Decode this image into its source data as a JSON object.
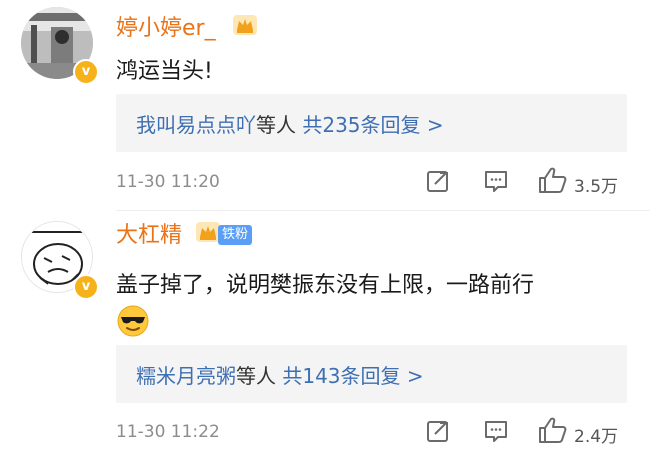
{
  "comments": [
    {
      "username": "婷小婷er_",
      "text": "鸿运当头!",
      "reply": {
        "users": "我叫易点点吖",
        "mid": "等人",
        "count": "共235条回复 >"
      },
      "time": "11-30 11:20",
      "likes": "3.5万",
      "avatar_icon": "user-photo-avatar",
      "badge_icon": "crown-icon"
    },
    {
      "username": "大杠精",
      "fan_badge": "铁粉",
      "text": "盖子掉了，说明樊振东没有上限，一路前行",
      "emoji_icon": "cool-sunglasses-emoji",
      "reply": {
        "users": "糯米月亮粥",
        "mid": "等人",
        "count": "共143条回复 >"
      },
      "time": "11-30 11:22",
      "likes": "2.4万",
      "avatar_icon": "doodle-face-avatar",
      "badge_icon": "crown-icon"
    }
  ],
  "colors": {
    "username": "#ea7317",
    "link": "#3e6fb2",
    "meta": "#8c8c8c",
    "reply_bg": "#f4f4f4",
    "verified": "#f6b21b",
    "fan_badge": "#5a9ff5"
  }
}
